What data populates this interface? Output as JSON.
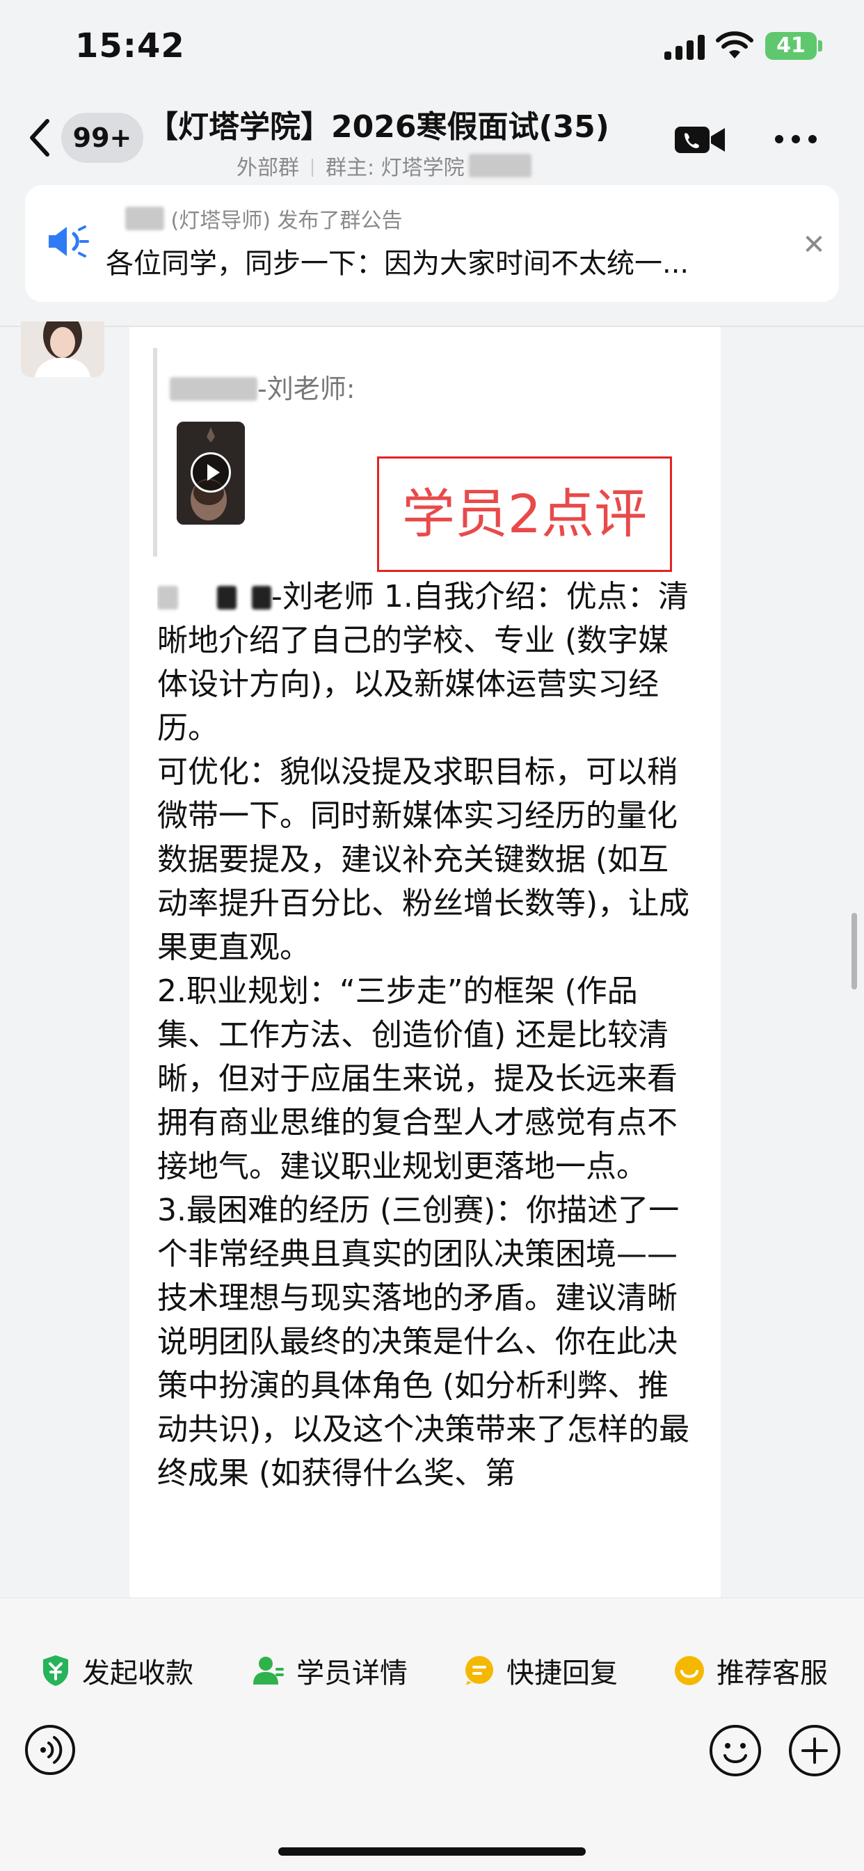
{
  "status_bar": {
    "time": "15:42",
    "battery": "41"
  },
  "header": {
    "unread_badge": "99+",
    "title": "【灯塔学院】2026寒假面试(35)",
    "subtitle_type": "外部群",
    "subtitle_owner": "群主: 灯塔学院"
  },
  "announcement": {
    "meta": "(灯塔导师) 发布了群公告",
    "text": "各位同学，同步一下：因为大家时间不太统一..."
  },
  "message": {
    "quote_author": "-刘老师:",
    "annotation": "学员2点评",
    "sender_tag": "-刘老师",
    "body": " 1.自我介绍：优点：清晰地介绍了自己的学校、专业 (数字媒体设计方向)，以及新媒体运营实习经历。\n可优化：貌似没提及求职目标，可以稍微带一下。同时新媒体实习经历的量化数据要提及，建议补充关键数据 (如互动率提升百分比、粉丝增长数等)，让成果更直观。\n2.职业规划：“三步走”的框架 (作品集、工作方法、创造价值) 还是比较清晰，但对于应届生来说，提及长远来看拥有商业思维的复合型人才感觉有点不接地气。建议职业规划更落地一点。\n3.最困难的经历 (三创赛)：你描述了一个非常经典且真实的团队决策困境——技术理想与现实落地的矛盾。建议清晰说明团队最终的决策是什么、你在此决策中扮演的具体角色 (如分析利弊、推动共识)，以及这个决策带来了怎样的最终成果 (如获得什么奖、第"
  },
  "toolbar": {
    "payment_label": "发起收款",
    "student_label": "学员详情",
    "quick_reply_label": "快捷回复",
    "service_label": "推荐客服"
  },
  "colors": {
    "accent_red": "#e32323",
    "payment_green": "#27b35a",
    "student_green": "#2fb24c",
    "quick_yellow": "#f5b800",
    "battery_green": "#5fc86e"
  }
}
